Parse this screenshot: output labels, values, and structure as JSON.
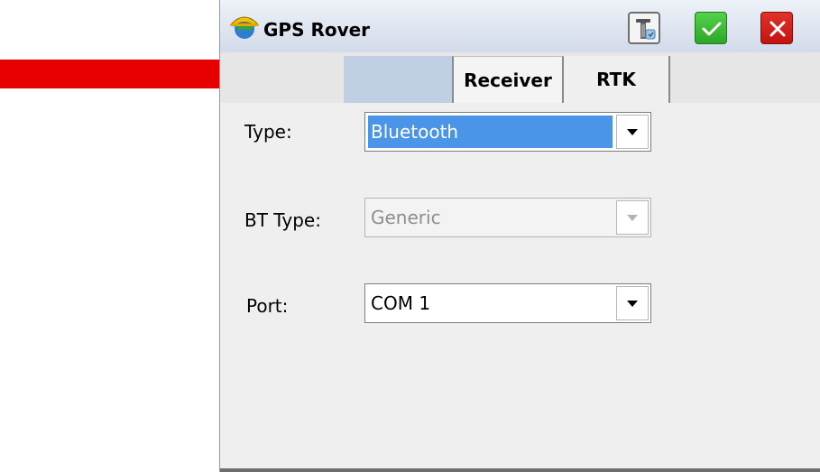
{
  "window": {
    "title": "GPS Rover",
    "icons": {
      "app": "survey-helmet-globe-icon",
      "instrument": "gps-receiver-icon",
      "ok": "checkmark-icon",
      "cancel": "close-icon"
    },
    "colors": {
      "ok": "#2ea628",
      "cancel": "#c2140f",
      "selection": "#4b95e8",
      "annotation_arrow": "#e60000"
    }
  },
  "tabs": [
    {
      "label": ""
    },
    {
      "label": "Receiver"
    },
    {
      "label": "RTK"
    }
  ],
  "fields": {
    "type": {
      "label": "Type:",
      "value": "Bluetooth"
    },
    "bt_type": {
      "label": "BT Type:",
      "value": "Generic"
    },
    "port": {
      "label": "Port:",
      "value": "COM 1"
    }
  }
}
